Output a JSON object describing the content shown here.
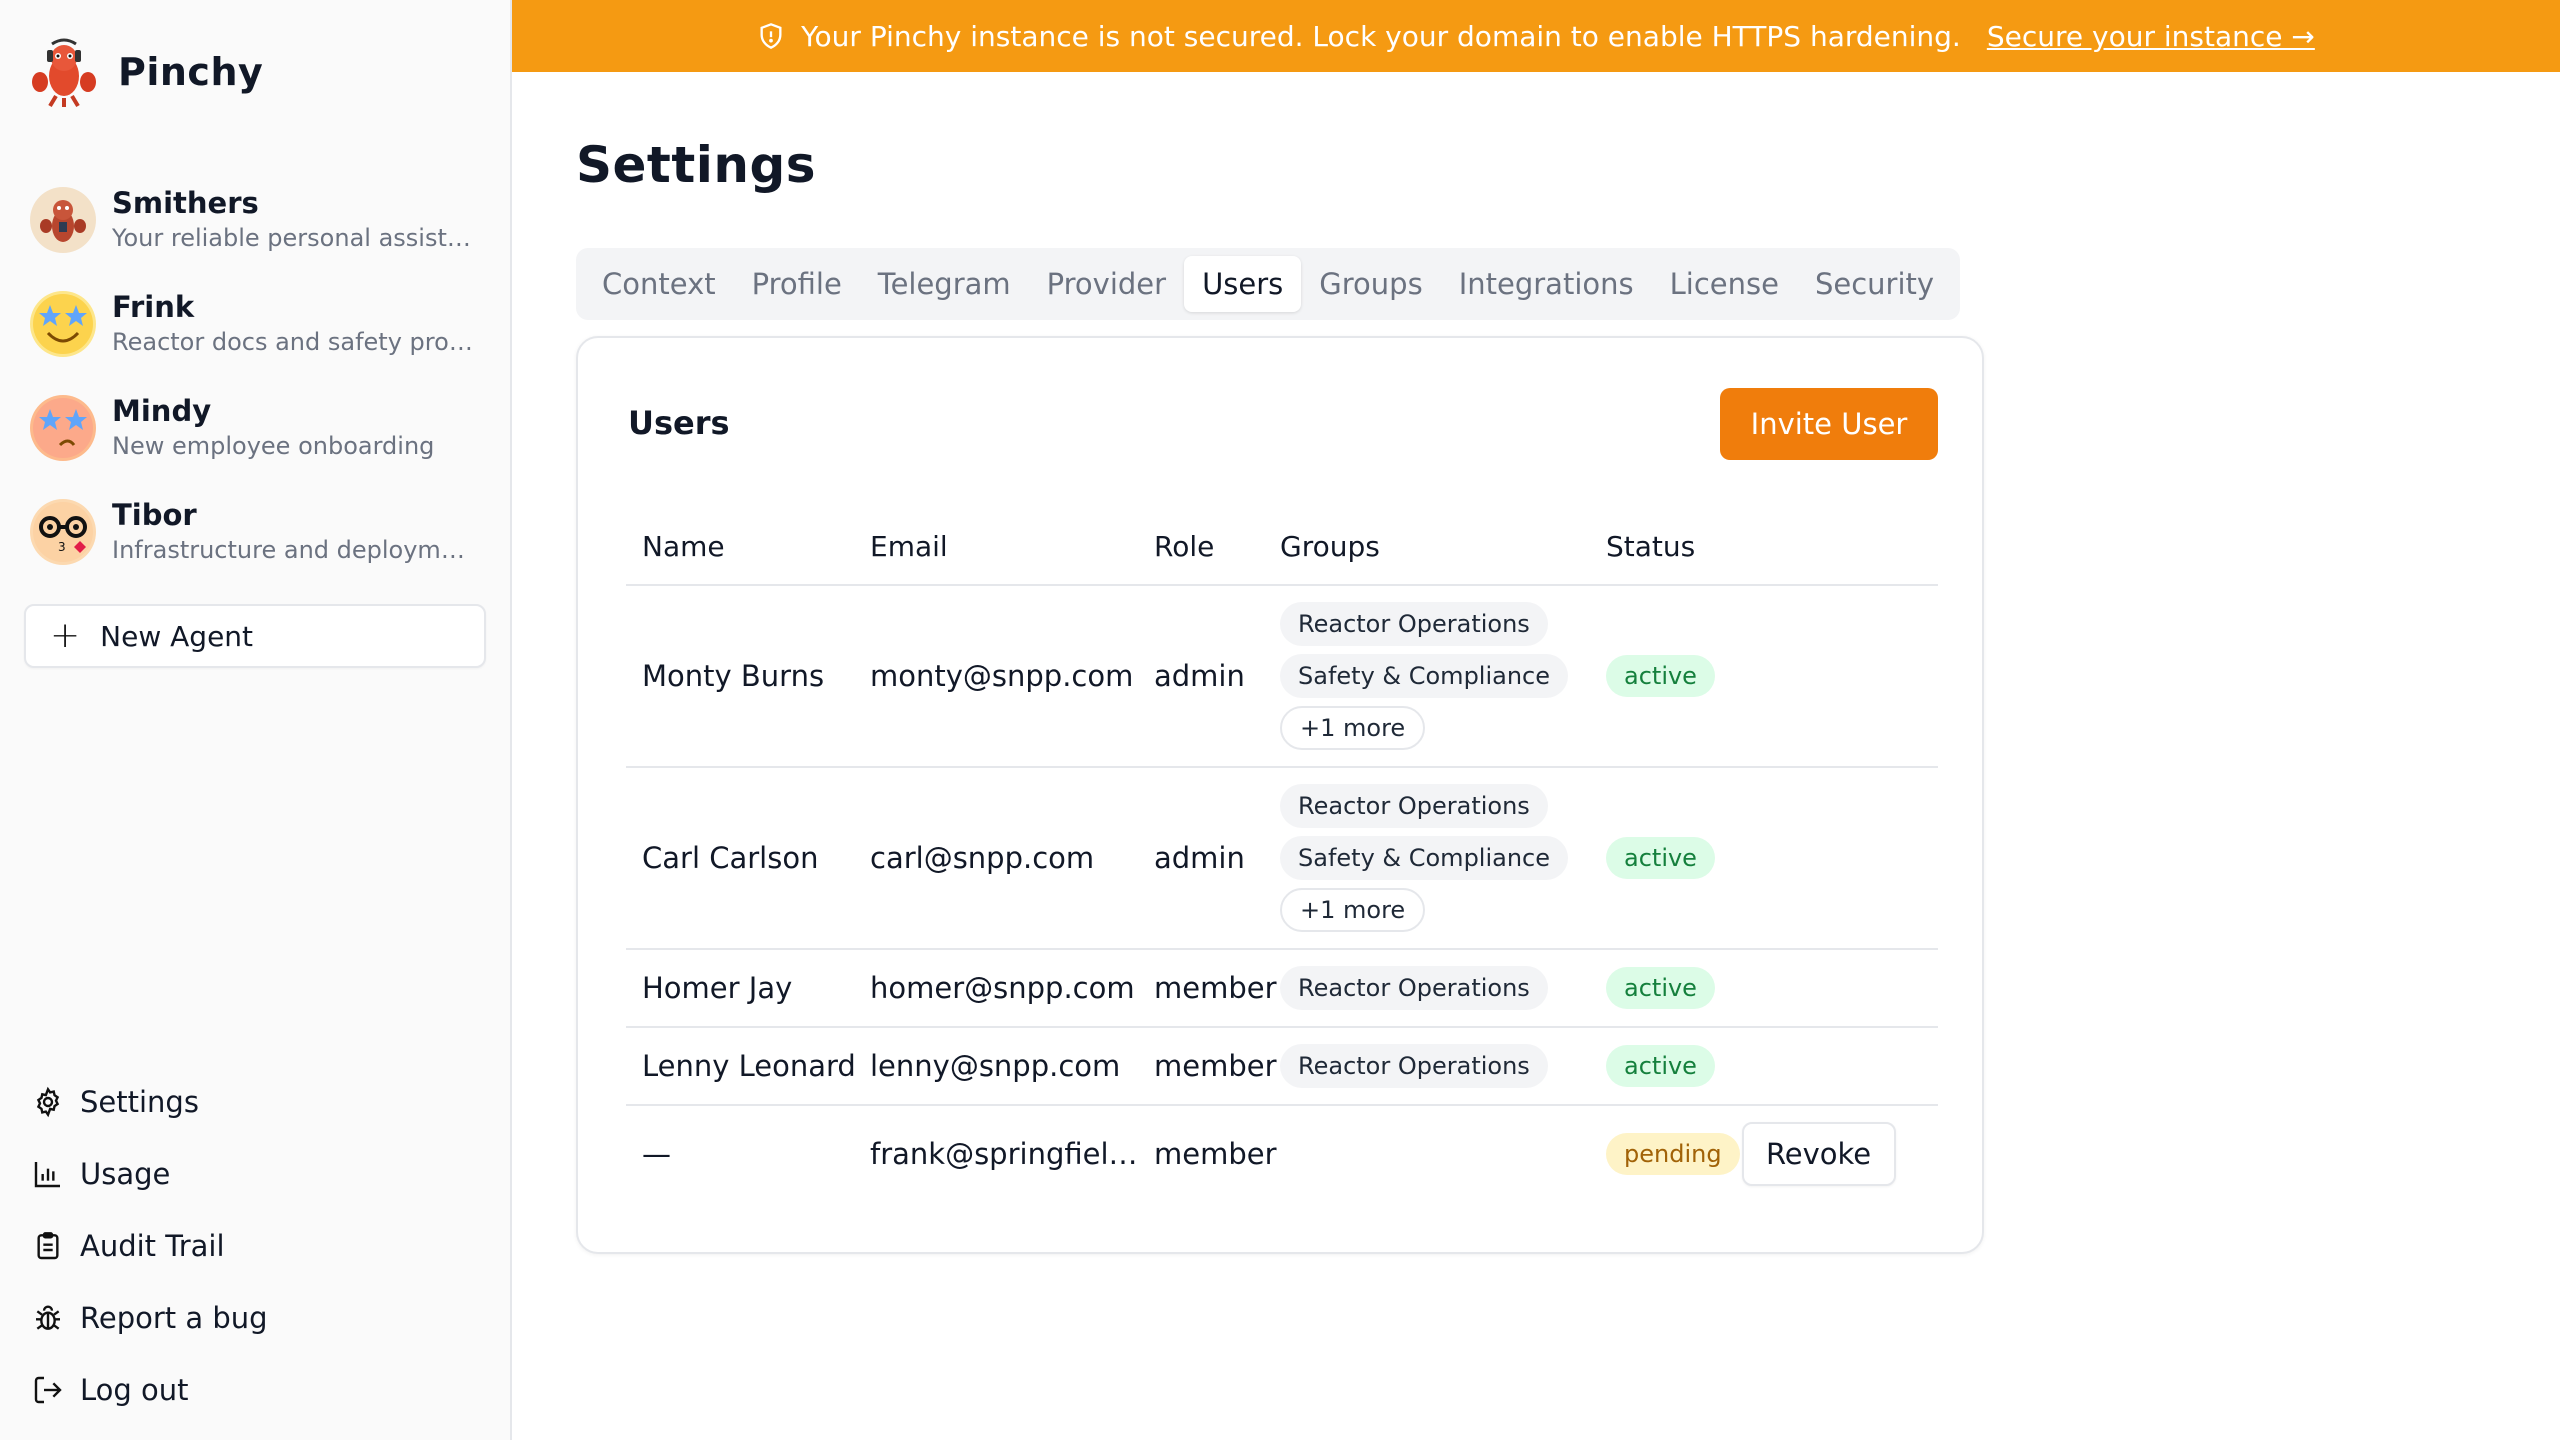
{
  "brand": {
    "name": "Pinchy",
    "logo_icon": "lobster-logo-icon"
  },
  "agents": [
    {
      "name": "Smithers",
      "description": "Your reliable personal assistant",
      "avatar_color": "#f3e1c8"
    },
    {
      "name": "Frink",
      "description": "Reactor docs and safety procedures",
      "avatar_color": "#fde68a"
    },
    {
      "name": "Mindy",
      "description": "New employee onboarding",
      "avatar_color": "#fdba8c"
    },
    {
      "name": "Tibor",
      "description": "Infrastructure and deployments",
      "avatar_color": "#fcd9b0"
    }
  ],
  "new_agent_label": "New Agent",
  "nav": {
    "settings": "Settings",
    "usage": "Usage",
    "audit_trail": "Audit Trail",
    "report_bug": "Report a bug",
    "logout": "Log out"
  },
  "banner": {
    "message": "Your Pinchy instance is not secured. Lock your domain to enable HTTPS hardening.",
    "link": "Secure your instance →",
    "color": "#f59a12"
  },
  "page_title": "Settings",
  "tabs": [
    "Context",
    "Profile",
    "Telegram",
    "Provider",
    "Users",
    "Groups",
    "Integrations",
    "License",
    "Security"
  ],
  "active_tab": "Users",
  "users_card": {
    "title": "Users",
    "invite_button": "Invite User",
    "columns": [
      "Name",
      "Email",
      "Role",
      "Groups",
      "Status"
    ],
    "rows": [
      {
        "name": "Monty Burns",
        "email": "monty@snpp.com",
        "role": "admin",
        "groups": [
          "Reactor Operations",
          "Safety & Compliance"
        ],
        "more": "+1 more",
        "status": "active"
      },
      {
        "name": "Carl Carlson",
        "email": "carl@snpp.com",
        "role": "admin",
        "groups": [
          "Reactor Operations",
          "Safety & Compliance"
        ],
        "more": "+1 more",
        "status": "active"
      },
      {
        "name": "Homer Jay",
        "email": "homer@snpp.com",
        "role": "member",
        "groups": [
          "Reactor Operations"
        ],
        "more": "",
        "status": "active"
      },
      {
        "name": "Lenny Leonard",
        "email": "lenny@snpp.com",
        "role": "member",
        "groups": [
          "Reactor Operations"
        ],
        "more": "",
        "status": "active"
      },
      {
        "name": "—",
        "email": "frank@springfield.com",
        "role": "member",
        "groups": [],
        "more": "",
        "status": "pending",
        "action": "Revoke"
      }
    ]
  },
  "accent_color": "#f07d0c"
}
